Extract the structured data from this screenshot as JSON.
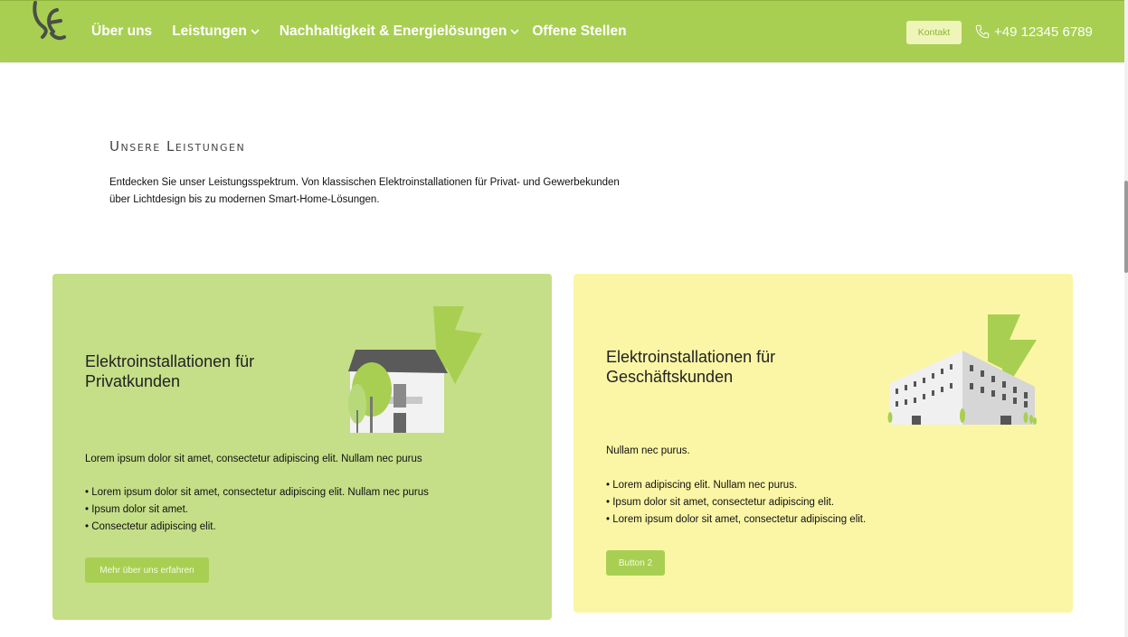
{
  "header": {
    "nav": [
      {
        "label": "Über uns",
        "has_dropdown": false
      },
      {
        "label": "Leistungen",
        "has_dropdown": true
      },
      {
        "label": "Nachhaltigkeit & Energielösungen",
        "has_dropdown": true
      },
      {
        "label": "Offene Stellen",
        "has_dropdown": false
      }
    ],
    "contact_label": "Kontakt",
    "phone": "+49 12345 6789",
    "icons": {
      "logo": "company-logo",
      "phone": "phone-icon",
      "dropdown": "chevron-down-icon"
    }
  },
  "intro": {
    "title": "Unsere Leistungen",
    "line1": "Entdecken Sie unser Leistungsspektrum. Von klassischen Elektroinstallationen für Privat- und Gewerbekunden",
    "line2": "über Lichtdesign bis zu modernen Smart-Home-Lösungen."
  },
  "cards": [
    {
      "title_line1": "Elektroinstallationen für",
      "title_line2": "Privatkunden",
      "text": "Lorem ipsum dolor sit amet, consectetur adipiscing elit. Nullam nec purus",
      "bullets": [
        "Lorem ipsum dolor sit amet, consectetur adipiscing elit. Nullam nec purus",
        "Ipsum dolor sit amet.",
        "Consectetur adipiscing elit."
      ],
      "button": "Mehr über uns erfahren",
      "illustration": "house-with-lightning-icon"
    },
    {
      "title_line1": "Elektroinstallationen für",
      "title_line2": "Geschäftskunden",
      "text": "Nullam nec purus.",
      "bullets": [
        "Lorem adipiscing elit. Nullam nec purus.",
        "Ipsum dolor sit amet, consectetur adipiscing elit.",
        "Lorem ipsum dolor sit amet, consectetur adipiscing elit."
      ],
      "button": "Button 2",
      "illustration": "office-building-with-lightning-icon"
    }
  ],
  "colors": {
    "brand_green": "#a8cf52",
    "card_green": "#c5df88",
    "card_yellow": "#fbf6a6",
    "contact_bg": "#eff5b8"
  }
}
